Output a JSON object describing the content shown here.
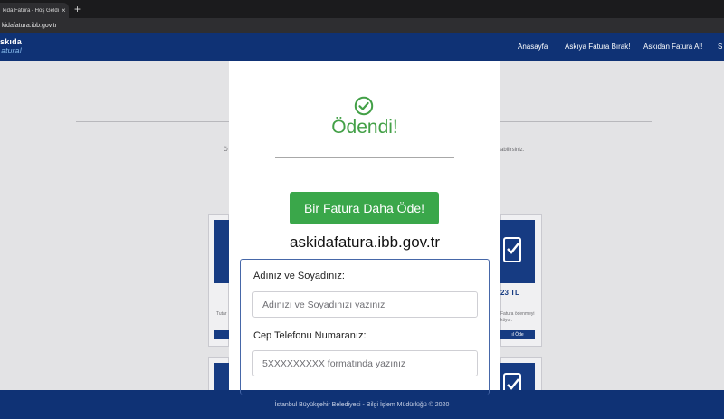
{
  "browser": {
    "tab_title": "kıda Fatura - Hoş Geldi",
    "tab_close": "×",
    "new_tab": "+",
    "url": "kidafatura.ibb.gov.tr"
  },
  "site": {
    "logo": {
      "line1": "skıda",
      "line2": "atura!"
    },
    "nav": [
      {
        "label": "Anasayfa"
      },
      {
        "label": "Askıya Fatura Bırak!"
      },
      {
        "label": "Askıdan Fatura Al!"
      },
      {
        "label": "S"
      }
    ],
    "background": {
      "left_fragment": "Ö",
      "right_fragment": "abilirsiniz.",
      "card_left_text": "Tutar",
      "card_right_price": "23 TL",
      "card_right_text1": "Fatura ödenmeyi",
      "card_right_text2": "ktiyor.",
      "card_right_button": "ıl Öde"
    },
    "footer": "İstanbul Büyükşehir Belediyesi - Bilgi İşlem Müdürlüğü © 2020"
  },
  "modal": {
    "status_icon": "check-circle-icon",
    "status_title": "Ödendi!",
    "pay_again_button": "Bir Fatura Daha Öde!",
    "domain": "askidafatura.ibb.gov.tr",
    "form": {
      "name_label": "Adınız ve Soyadınız:",
      "name_placeholder": "Adınızı ve Soyadınızı yazınız",
      "phone_label": "Cep Telefonu Numaranız:",
      "phone_placeholder": "5XXXXXXXXX formatında yazınız"
    }
  },
  "colors": {
    "navy": "#0f3275",
    "success_green": "#43a047",
    "button_green": "#3aa74a"
  }
}
